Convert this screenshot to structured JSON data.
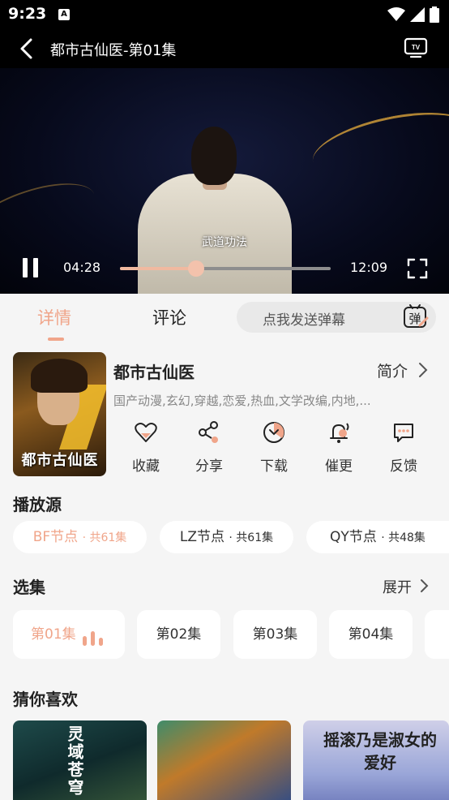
{
  "status_bar": {
    "time": "9:23",
    "notification_letter": "A"
  },
  "player": {
    "title": "都市古仙医-第01集",
    "subtitle": "武道功法",
    "current_time": "04:28",
    "total_time": "12:09",
    "progress": 0.36
  },
  "tabs": {
    "detail": "详情",
    "comment": "评论",
    "danmaku_placeholder": "点我发送弹幕",
    "danmaku_icon_text": "弹"
  },
  "show": {
    "title": "都市古仙医",
    "intro_label": "简介",
    "tags": "国产动漫,玄幻,穿越,恋爱,热血,文学改编,内地,...",
    "poster_title": "都市古仙医"
  },
  "actions": [
    {
      "label": "收藏",
      "icon": "heart-icon"
    },
    {
      "label": "分享",
      "icon": "share-icon"
    },
    {
      "label": "下载",
      "icon": "download-icon"
    },
    {
      "label": "催更",
      "icon": "bell-icon"
    },
    {
      "label": "反馈",
      "icon": "feedback-icon"
    }
  ],
  "sources": {
    "title": "播放源",
    "items": [
      {
        "name": "BF节点",
        "count": "· 共61集",
        "active": true
      },
      {
        "name": "LZ节点",
        "count": "· 共61集",
        "active": false
      },
      {
        "name": "QY节点",
        "count": "· 共48集",
        "active": false
      }
    ]
  },
  "episodes": {
    "title": "选集",
    "expand_label": "展开",
    "items": [
      "第01集",
      "第02集",
      "第03集",
      "第04集"
    ]
  },
  "recommend": {
    "title": "猜你喜欢",
    "items": [
      {
        "text": "灵域苍穹"
      },
      {
        "text": ""
      },
      {
        "text": "摇滚乃是淑女的爱好"
      }
    ]
  },
  "colors": {
    "accent": "#f0a58a",
    "background": "#f5f5f5",
    "player_bg": "#000000"
  }
}
